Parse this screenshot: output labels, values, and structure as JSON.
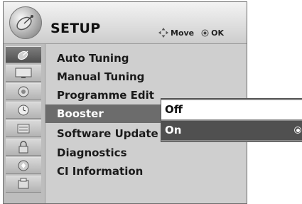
{
  "menu": {
    "title": "SETUP",
    "hint": {
      "move_label": "Move",
      "ok_label": "OK"
    },
    "categories": [
      {
        "icon": "satellite-dish-icon",
        "active": true
      },
      {
        "icon": "picture-icon",
        "active": false
      },
      {
        "icon": "speaker-icon",
        "active": false
      },
      {
        "icon": "clock-icon",
        "active": false
      },
      {
        "icon": "settings-icon",
        "active": false
      },
      {
        "icon": "lock-icon",
        "active": false
      },
      {
        "icon": "network-icon",
        "active": false
      },
      {
        "icon": "usb-icon",
        "active": false
      }
    ],
    "items": [
      {
        "label": "Auto Tuning"
      },
      {
        "label": "Manual Tuning"
      },
      {
        "label": "Programme Edit"
      },
      {
        "label": "Booster",
        "selected": true
      },
      {
        "label": "Software Update"
      },
      {
        "label": "Diagnostics"
      },
      {
        "label": "CI Information"
      }
    ]
  },
  "booster_popup": {
    "options": [
      {
        "label": "Off",
        "highlighted": false
      },
      {
        "label": "On",
        "highlighted": true,
        "radio_selected": true
      }
    ]
  },
  "colors": {
    "panel_background": "#cfcfcf",
    "selected_item": "#6c6c6c",
    "popup_highlight": "#505050"
  }
}
